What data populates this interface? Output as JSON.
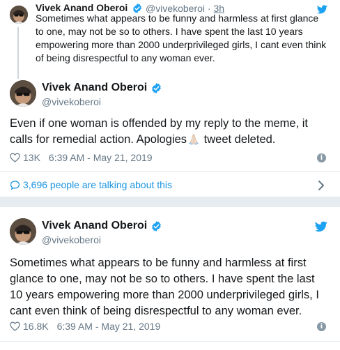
{
  "quoted_tweet": {
    "author_name": "Vivek Anand Oberoi",
    "handle": "@vivekoberoi",
    "separator": "·",
    "time_ago": "3h",
    "text": "Sometimes what appears to be funny and harmless at first glance to one, may not be so to others. I have spent the last 10 years empowering more than 2000 underprivileged girls, I cant even think of being disrespectful to any woman ever."
  },
  "main_tweet": {
    "author_name": "Vivek Anand Oberoi",
    "handle": "@vivekoberoi",
    "text_before_emoji": "Even if one woman is offended by my reply to the meme, it calls for remedial action. Apologies",
    "text_after_emoji": " tweet deleted.",
    "likes": "13K",
    "timestamp": "6:39 AM - May 21, 2019",
    "talking_text": "3,696 people are talking about this"
  },
  "second_tweet": {
    "author_name": "Vivek Anand Oberoi",
    "handle": "@vivekoberoi",
    "text": "Sometimes what appears to be funny and harmless at first glance to one, may not be so to others. I have spent the last 10 years empowering more than 2000 underprivileged girls, I cant even think of being disrespectful to any woman ever.",
    "likes": "16.8K",
    "timestamp": "6:39 AM - May 21, 2019"
  },
  "icons": {
    "verified": "verified-badge-icon",
    "twitter": "twitter-bird-icon",
    "heart": "heart-icon",
    "info": "info-icon",
    "reply_bubble": "speech-bubble-icon",
    "chevron": "chevron-right-icon"
  },
  "colors": {
    "twitter_blue": "#1da1f2",
    "link_blue": "#1b95e0",
    "muted_gray": "#657786",
    "text": "#14171a",
    "background": "#e6ecf0"
  }
}
